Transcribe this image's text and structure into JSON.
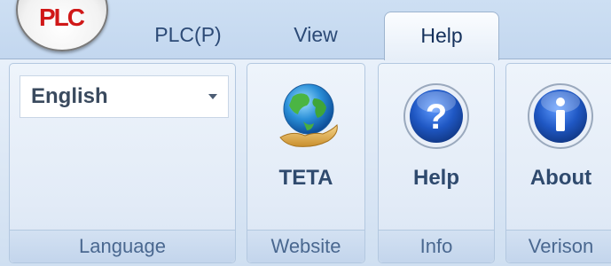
{
  "app": {
    "logo_text": "PLC"
  },
  "tabs": [
    {
      "label": "PLC(P)",
      "selected": false
    },
    {
      "label": "View",
      "selected": false
    },
    {
      "label": "Help",
      "selected": true
    }
  ],
  "ribbon": {
    "language": {
      "group_label": "Language",
      "selected_value": "English"
    },
    "website": {
      "group_label": "Website",
      "button_label": "TETA",
      "icon": "globe-hand-icon"
    },
    "info": {
      "group_label": "Info",
      "button_label": "Help",
      "icon": "question-icon"
    },
    "version": {
      "group_label": "Verison",
      "button_label": "About",
      "icon": "info-icon"
    }
  },
  "colors": {
    "tab_text": "#2c4a76",
    "icon_blue": "#1f57c3",
    "group_label_text": "#4a6890"
  }
}
